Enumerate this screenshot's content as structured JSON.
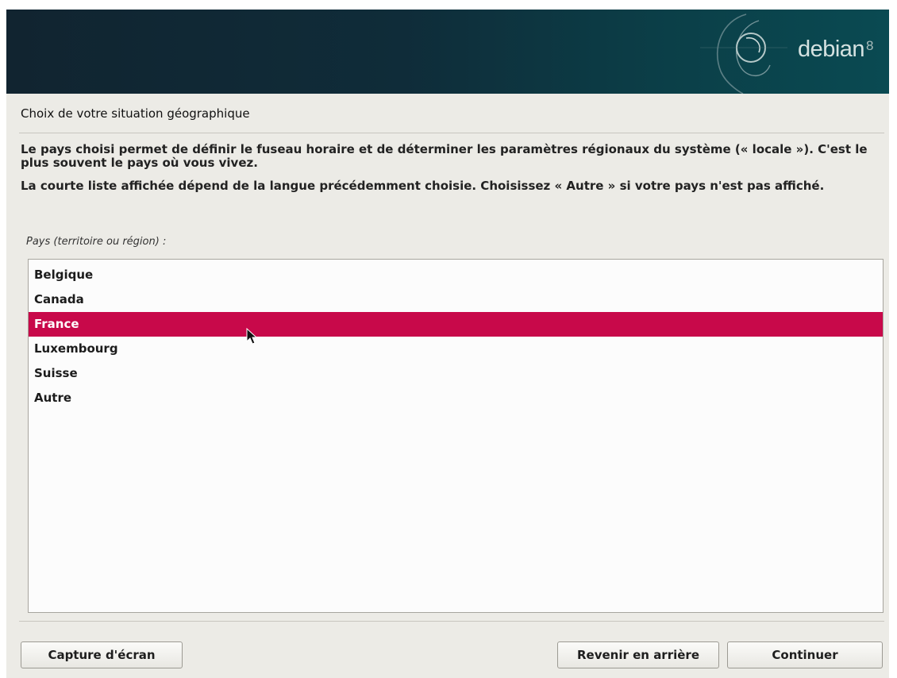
{
  "banner": {
    "logo_text": "debian",
    "version": "8"
  },
  "page_title": "Choix de votre situation géographique",
  "description": {
    "paragraph1": "Le pays choisi permet de définir le fuseau horaire et de déterminer les paramètres régionaux du système (« locale »). C'est le plus souvent le pays où vous vivez.",
    "paragraph2": "La courte liste affichée dépend de la langue précédemment choisie. Choisissez « Autre » si votre pays n'est pas affiché."
  },
  "field_label": "Pays (territoire ou région) :",
  "countries": {
    "items": [
      {
        "label": "Belgique"
      },
      {
        "label": "Canada"
      },
      {
        "label": "France",
        "selected": true
      },
      {
        "label": "Luxembourg"
      },
      {
        "label": "Suisse"
      },
      {
        "label": "Autre"
      }
    ]
  },
  "buttons": {
    "screenshot": "Capture d'écran",
    "back": "Revenir en arrière",
    "continue": "Continuer"
  },
  "colors": {
    "selection": "#c8094a",
    "background": "#ecebe6",
    "banner": "#0f2c39"
  },
  "icons": {
    "banner_swirl": "debian-swirl-icon",
    "cursor": "mouse-pointer-icon"
  }
}
